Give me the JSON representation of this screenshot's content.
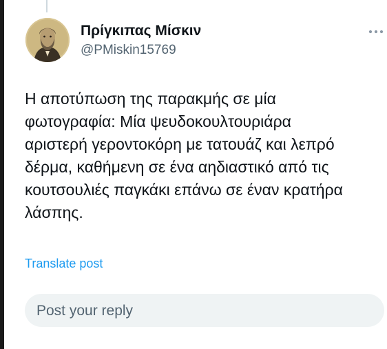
{
  "user": {
    "display_name": "Πρίγκιπας Μίσκιν",
    "handle": "@PMiskin15769"
  },
  "tweet": {
    "text": "Η αποτύπωση της παρακμής σε μία\nφωτογραφία: Μία ψευδοκουλτουριάρα\nαριστερή γεροντοκόρη με τατουάζ και λεπρό\nδέρμα, καθήμενη σε ένα αηδιαστικό από τις\nκουτσουλιές παγκάκι επάνω σε έναν κρατήρα\nλάσπης."
  },
  "actions": {
    "translate_label": "Translate post",
    "more_icon": "more-horizontal-icon"
  },
  "reply": {
    "placeholder": "Post your reply"
  },
  "colors": {
    "text_primary": "#0f1419",
    "text_secondary": "#536471",
    "link": "#1d9bf0",
    "reply_bg": "#eff3f4",
    "thread_line": "#cfd9de"
  }
}
